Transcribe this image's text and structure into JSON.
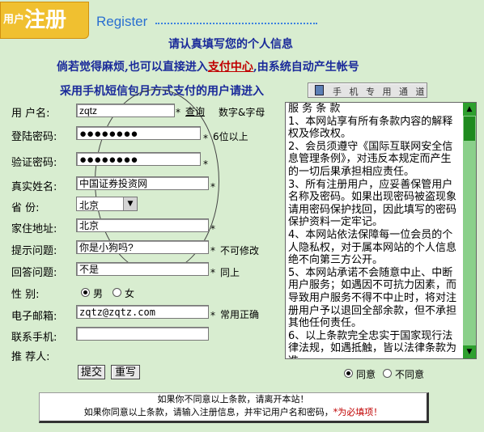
{
  "header": {
    "badge_small": "用户",
    "badge_big": "注册",
    "english": "Register"
  },
  "intro": {
    "line1": "请认真填写您的个人信息",
    "line2_prefix": "倘若觉得麻烦,也可以直接进入",
    "line2_link": "支付中心",
    "line2_suffix": ",由系统自动产生帐号",
    "line3": "采用手机短信包月方式支付的用户请进入",
    "phone_button": "手 机 专 用 通 道"
  },
  "form": {
    "username": {
      "label": "用  户名:",
      "value": "zqtz",
      "check": "查询",
      "note": "数字&字母"
    },
    "password": {
      "label": "登陆密码:",
      "value": "●●●●●●●●",
      "note": "6位以上"
    },
    "confirm": {
      "label": "验证密码:",
      "value": "●●●●●●●●"
    },
    "realname": {
      "label": "真实姓名:",
      "value": "中国证券投资网"
    },
    "province": {
      "label": "省    份:",
      "value": "北京"
    },
    "address": {
      "label": "家住地址:",
      "value": "北京"
    },
    "question": {
      "label": "提示问题:",
      "value": "你是小狗吗?",
      "note": "不可修改"
    },
    "answer": {
      "label": "回答问题:",
      "value": "不是",
      "note": "同上"
    },
    "gender": {
      "label": "性    别:",
      "male": "男",
      "female": "女",
      "selected": "male"
    },
    "email": {
      "label": "电子邮箱:",
      "value": "zqtz@zqtz.com",
      "note": "常用正确"
    },
    "mobile": {
      "label": "联系手机:",
      "value": ""
    },
    "referrer": {
      "label": "推  荐人:"
    },
    "star": "*",
    "submit": "提交",
    "reset": "重写"
  },
  "terms": {
    "lines": [
      "服 务 条 款",
      "1、本网站享有所有条款内容的解释权及修改权。",
      "2、会员须遵守《国际互联网安全信息管理条例》，对违反本规定而产生的一切后果承担相应责任。",
      "3、所有注册用户，应妥善保管用户名称及密码。如果出现密码被盗现象请用密码保护找回，因此填写的密码保护资料一定牢记。",
      "4、本网站依法保障每一位会员的个人隐私权，对于属本网站的个人信息绝不向第三方公开。",
      "5、本网站承诺不会随意中止、中断用户服务；如遇因不可抗力因素，而导致用户服务不得不中止时，将对注册用户予以退回全部余款，但不承担其他任何责任。",
      "6、以上条款完全忠实于国家现行法律法规，如遇抵触，皆以法律条款为准。"
    ],
    "agree": "同意",
    "disagree": "不同意",
    "selected": "agree"
  },
  "notice": {
    "line1": "如果你不同意以上条款，请离开本站！",
    "line2": "如果你同意以上条款，请输入注册信息，并牢记用户名和密码，",
    "line2_required": "*为必填项！"
  }
}
